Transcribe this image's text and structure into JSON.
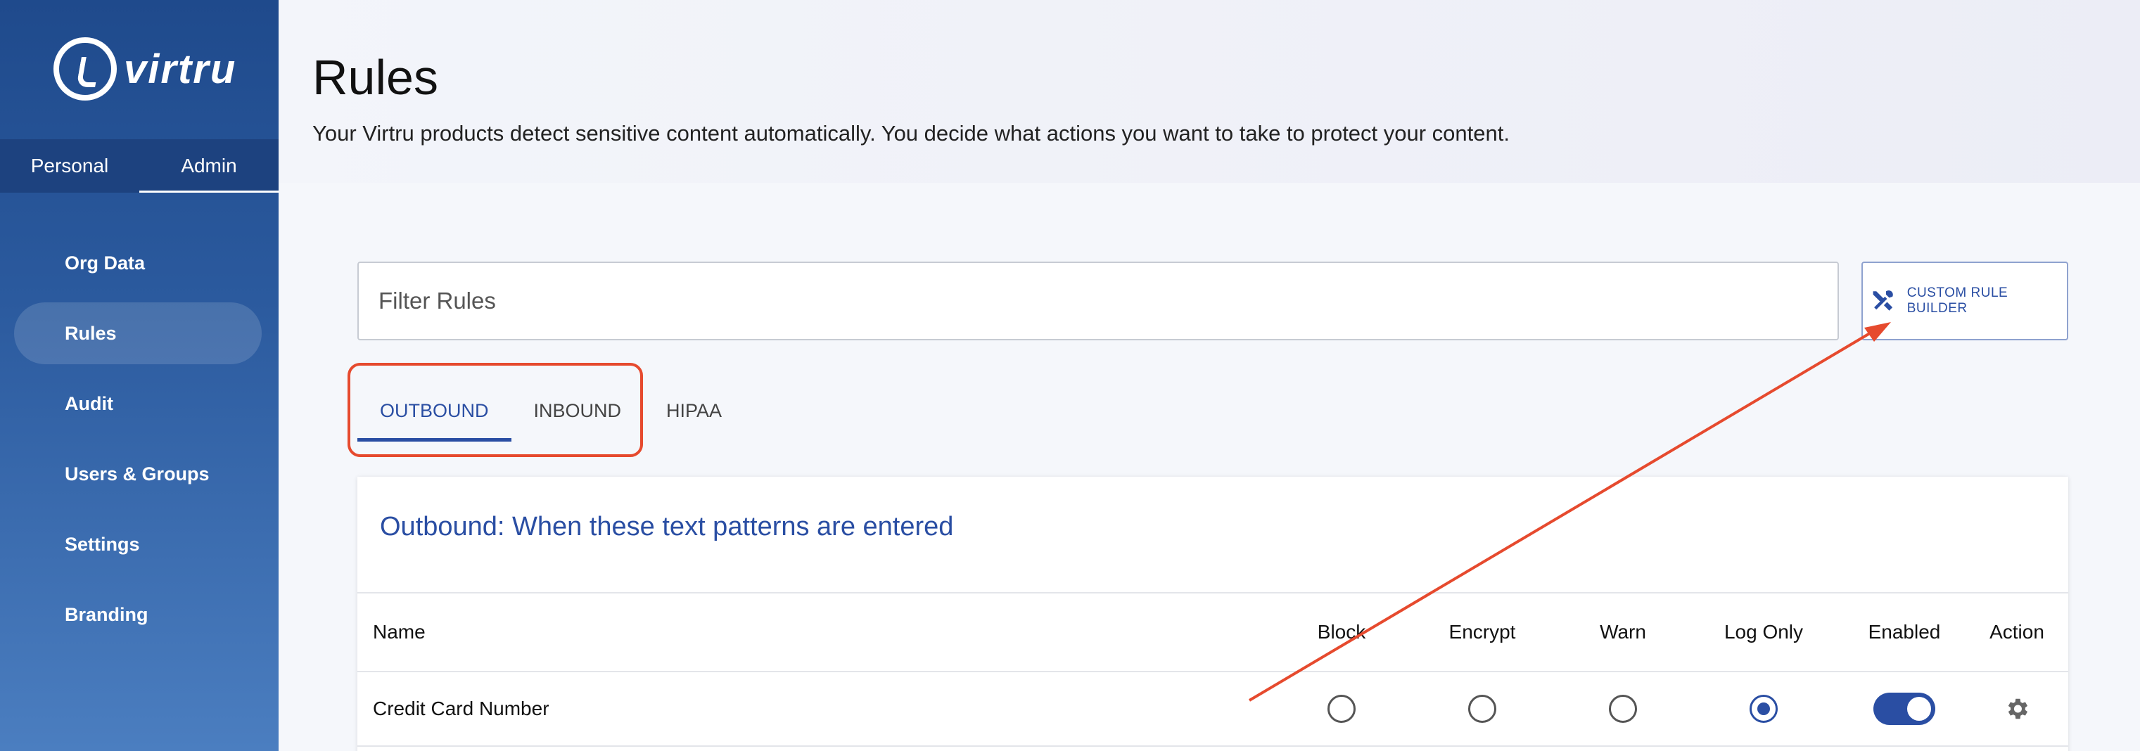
{
  "sidebar": {
    "brand": "virtru",
    "segments": [
      "Personal",
      "Admin"
    ],
    "nav": [
      "Org Data",
      "Rules",
      "Audit",
      "Users & Groups",
      "Settings",
      "Branding"
    ]
  },
  "header": {
    "title": "Rules",
    "subtitle": "Your Virtru products detect sensitive content automatically. You decide what actions you want to take to protect your content."
  },
  "filter": {
    "placeholder": "Filter Rules"
  },
  "custom_rule_builder": {
    "label": "CUSTOM RULE BUILDER",
    "icon": "tools-icon"
  },
  "tabs": [
    "OUTBOUND",
    "INBOUND",
    "HIPAA"
  ],
  "card": {
    "title": "Outbound: When these text patterns are entered",
    "columns": [
      "Name",
      "Block",
      "Encrypt",
      "Warn",
      "Log Only",
      "Enabled",
      "Action"
    ],
    "rows": [
      {
        "name": "Credit Card Number",
        "selected": "Log Only",
        "enabled": true,
        "action_icon": "gear-icon"
      }
    ]
  },
  "colors": {
    "accent": "#2a4ea3",
    "annotation": "#e64a2e",
    "sidebar": "#1f4a8c"
  }
}
